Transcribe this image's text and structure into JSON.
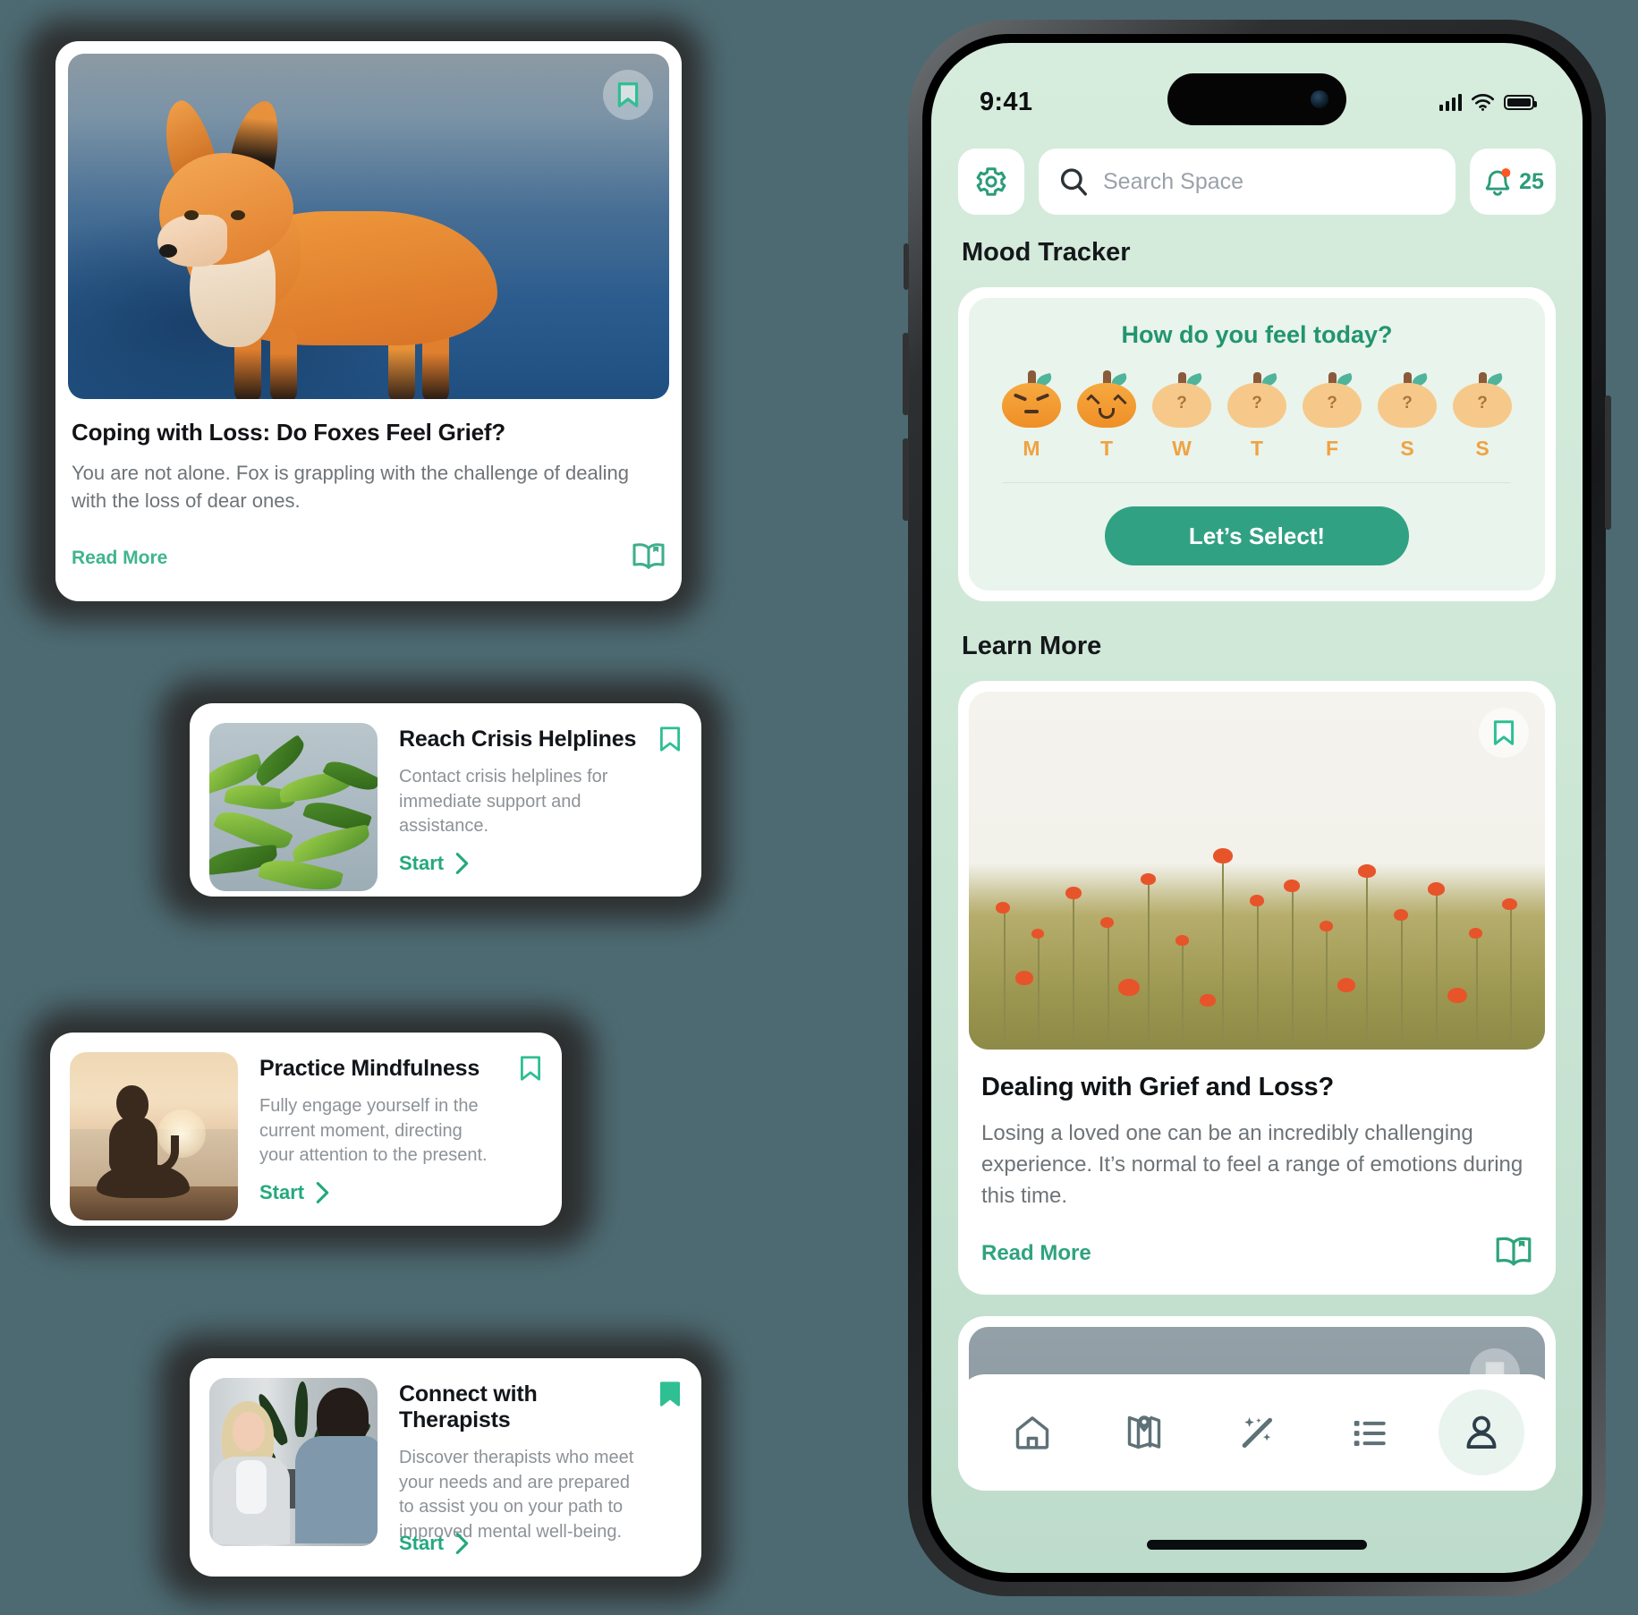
{
  "background_color": "#4d6a72",
  "accent_green": "#2fa37e",
  "hero_card": {
    "image": "fox-photo",
    "bookmark_icon": "bookmark-outline-icon",
    "bookmarked": false,
    "title": "Coping with Loss: Do Foxes Feel Grief?",
    "description": "You are not alone. Fox is grappling with the challenge of dealing with the loss of dear ones.",
    "read_more_label": "Read More",
    "book_icon": "open-book-icon"
  },
  "feature_cards": [
    {
      "thumb": "leaves-photo",
      "title": "Reach Crisis Helplines",
      "description": "Contact crisis helplines for immediate support and assistance.",
      "start_label": "Start",
      "bookmarked": false,
      "bookmark_icon": "bookmark-outline-icon",
      "chevron_icon": "chevron-right-icon"
    },
    {
      "thumb": "meditation-photo",
      "title": "Practice Mindfulness",
      "description": "Fully engage yourself in the current moment, directing your attention to the present.",
      "start_label": "Start",
      "bookmarked": false,
      "bookmark_icon": "bookmark-outline-icon",
      "chevron_icon": "chevron-right-icon"
    },
    {
      "thumb": "therapy-session-photo",
      "title": "Connect with Therapists",
      "description": "Discover therapists who meet your needs and are prepared to assist you on your path to improved mental well-being.",
      "start_label": "Start",
      "bookmarked": true,
      "bookmark_icon": "bookmark-filled-icon",
      "chevron_icon": "chevron-right-icon"
    }
  ],
  "phone": {
    "status_bar": {
      "time": "9:41",
      "cellular_icon": "signal-bars-icon",
      "wifi_icon": "wifi-icon",
      "battery_icon": "battery-full-icon"
    },
    "header": {
      "settings_icon": "gear-icon",
      "search_icon": "search-icon",
      "search_placeholder": "Search Space",
      "search_value": "",
      "bell_icon": "bell-icon",
      "notification_count": "25",
      "notification_dot_color": "#ff5722"
    },
    "mood_tracker": {
      "section_title": "Mood Tracker",
      "question": "How do you feel today?",
      "days": [
        {
          "label": "M",
          "state": "selected",
          "mood": "angry",
          "icon": "pumpkin-angry-icon"
        },
        {
          "label": "T",
          "state": "selected",
          "mood": "happy",
          "icon": "pumpkin-happy-icon"
        },
        {
          "label": "W",
          "state": "empty",
          "mood": "unknown",
          "icon": "pumpkin-question-icon"
        },
        {
          "label": "T",
          "state": "empty",
          "mood": "unknown",
          "icon": "pumpkin-question-icon"
        },
        {
          "label": "F",
          "state": "empty",
          "mood": "unknown",
          "icon": "pumpkin-question-icon"
        },
        {
          "label": "S",
          "state": "empty",
          "mood": "unknown",
          "icon": "pumpkin-question-icon"
        },
        {
          "label": "S",
          "state": "empty",
          "mood": "unknown",
          "icon": "pumpkin-question-icon"
        }
      ],
      "button_label": "Let’s Select!",
      "button_color": "#31a183"
    },
    "learn_more": {
      "section_title": "Learn More",
      "card": {
        "image": "poppy-field-photo",
        "bookmark_icon": "bookmark-outline-icon",
        "bookmarked": false,
        "title": "Dealing with Grief and Loss?",
        "description": "Losing a loved one can be an incredibly challenging experience. It’s normal to feel a range of emotions during this time.",
        "read_more_label": "Read More",
        "book_icon": "open-book-icon"
      },
      "next_card_peek": {
        "image": "fox-photo",
        "bookmark_icon": "bookmark-outline-icon"
      }
    },
    "tabbar": {
      "items": [
        {
          "icon": "home-icon",
          "active": false
        },
        {
          "icon": "map-pin-icon",
          "active": false
        },
        {
          "icon": "magic-wand-icon",
          "active": false
        },
        {
          "icon": "list-icon",
          "active": false
        },
        {
          "icon": "person-icon",
          "active": true
        }
      ]
    }
  }
}
